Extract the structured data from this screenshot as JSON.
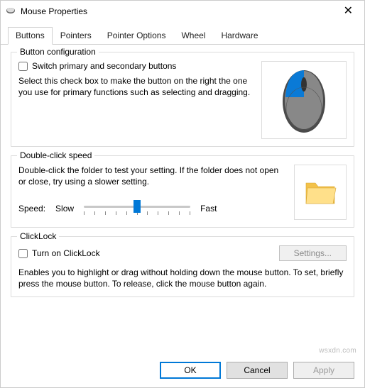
{
  "window": {
    "title": "Mouse Properties"
  },
  "tabs": {
    "t0": "Buttons",
    "t1": "Pointers",
    "t2": "Pointer Options",
    "t3": "Wheel",
    "t4": "Hardware"
  },
  "buttonConfig": {
    "legend": "Button configuration",
    "checkbox_label": "Switch primary and secondary buttons",
    "help": "Select this check box to make the button on the right the one you use for primary functions such as selecting and dragging."
  },
  "doubleClick": {
    "legend": "Double-click speed",
    "help": "Double-click the folder to test your setting. If the folder does not open or close, try using a slower setting.",
    "speed_label": "Speed:",
    "slow": "Slow",
    "fast": "Fast"
  },
  "clickLock": {
    "legend": "ClickLock",
    "checkbox_label": "Turn on ClickLock",
    "settings_btn": "Settings...",
    "help": "Enables you to highlight or drag without holding down the mouse button. To set, briefly press the mouse button. To release, click the mouse button again."
  },
  "dialog": {
    "ok": "OK",
    "cancel": "Cancel",
    "apply": "Apply"
  },
  "watermark": "wsxdn.com"
}
